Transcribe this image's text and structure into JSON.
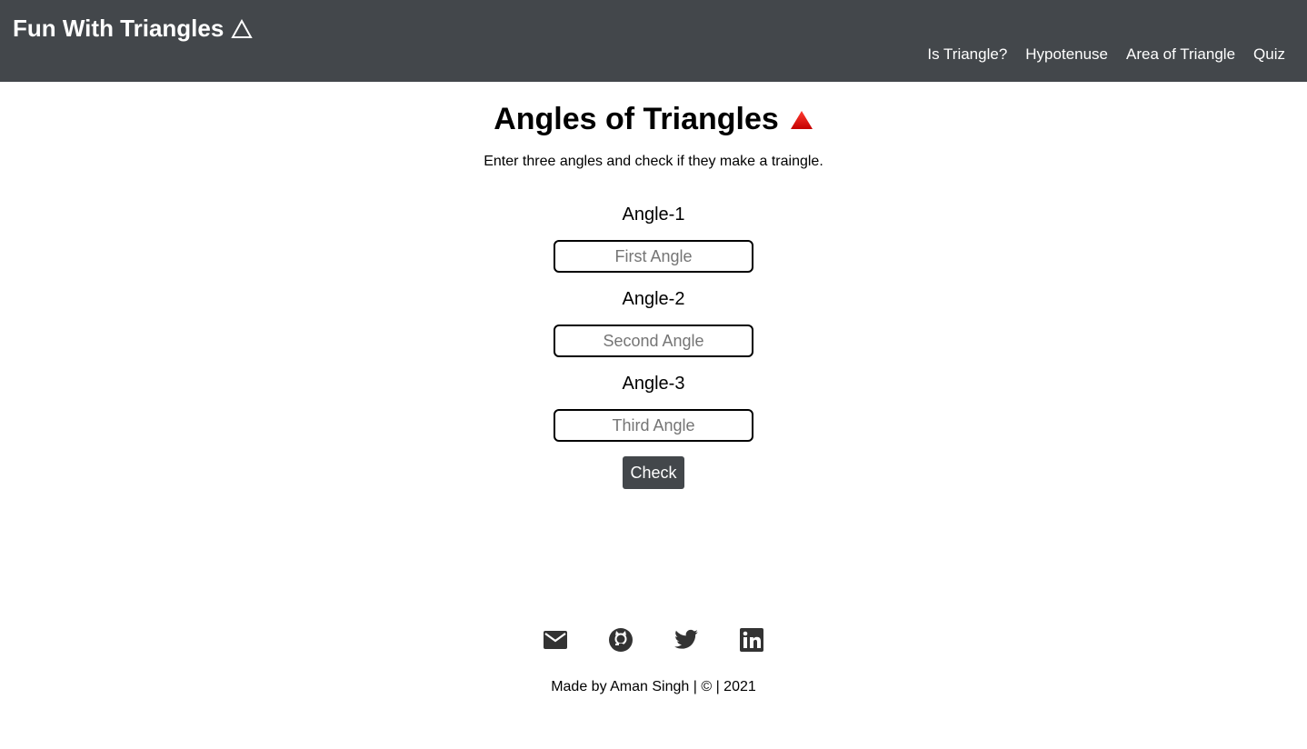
{
  "navbar": {
    "brand": "Fun With Triangles",
    "brand_icon": "triangle-outline-icon",
    "links": [
      "Is Triangle?",
      "Hypotenuse",
      "Area of Triangle",
      "Quiz"
    ]
  },
  "main": {
    "title": "Angles of Triangles",
    "title_icon": "red-triangle-icon",
    "subtitle": "Enter three angles and check if they make a traingle.",
    "fields": [
      {
        "label": "Angle-1",
        "placeholder": "First Angle",
        "value": ""
      },
      {
        "label": "Angle-2",
        "placeholder": "Second Angle",
        "value": ""
      },
      {
        "label": "Angle-3",
        "placeholder": "Third Angle",
        "value": ""
      }
    ],
    "check_label": "Check"
  },
  "footer": {
    "icons": [
      "mail-icon",
      "github-icon",
      "twitter-icon",
      "linkedin-icon"
    ],
    "text": "Made by Aman Singh | © | 2021"
  },
  "colors": {
    "navbar": "#43474b",
    "accent_red": "#e60000"
  }
}
